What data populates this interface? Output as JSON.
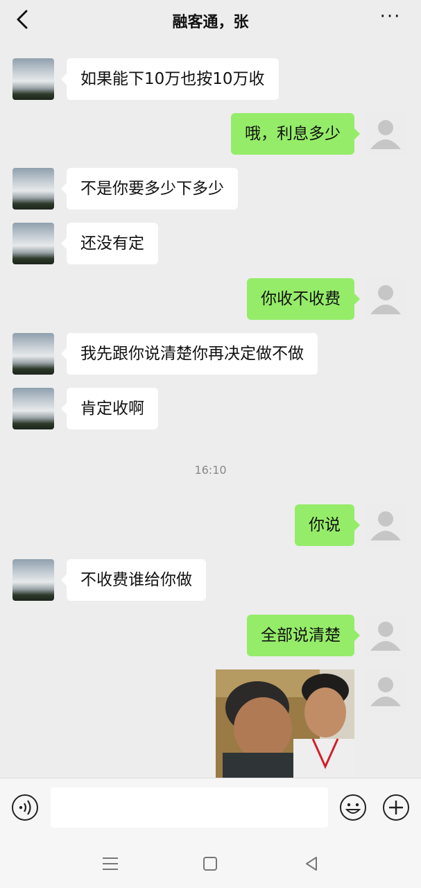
{
  "header": {
    "title": "融客通，张",
    "back_icon": "chevron-left-icon",
    "more_icon": "more-dots-icon"
  },
  "messages": [
    {
      "side": "left",
      "text": "如果能下10万也按10万收"
    },
    {
      "side": "right",
      "text": "哦，利息多少"
    },
    {
      "side": "left",
      "text": "不是你要多少下多少"
    },
    {
      "side": "left",
      "text": "还没有定"
    },
    {
      "side": "right",
      "text": "你收不收费"
    },
    {
      "side": "left",
      "text": "我先跟你说清楚你再决定做不做"
    },
    {
      "side": "left",
      "text": "肯定收啊"
    },
    {
      "side": "right",
      "text": "你说"
    },
    {
      "side": "left",
      "text": "不收费谁给你做"
    },
    {
      "side": "right",
      "text": "全部说清楚"
    }
  ],
  "timestamp": "16:10",
  "image_message": {
    "side": "right",
    "kind": "photo"
  },
  "input_bar": {
    "voice_icon": "voice-icon",
    "emoji_icon": "emoji-icon",
    "plus_icon": "plus-icon",
    "text": ""
  },
  "system_nav": {
    "menu_icon": "menu-icon",
    "home_icon": "home-icon",
    "back_icon": "triangle-back-icon"
  },
  "colors": {
    "background": "#ededed",
    "self_bubble": "#95ec69",
    "other_bubble": "#ffffff"
  }
}
